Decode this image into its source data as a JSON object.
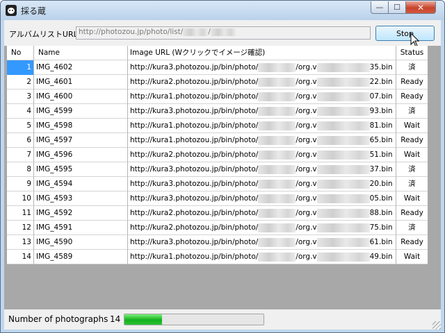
{
  "window": {
    "title": "採る蔵",
    "min_glyph": "—",
    "max_glyph": "☐",
    "close_glyph": "✕"
  },
  "album": {
    "label": "アルバムリストURL:",
    "url_prefix": "http://photozou.jp/photo/list/",
    "url_sep": "/"
  },
  "stop_button": {
    "label": "Stop"
  },
  "table": {
    "headers": {
      "no": "No",
      "name": "Name",
      "url": "Image URL (Wクリックでイメージ確認)",
      "status": "Status"
    },
    "rows": [
      {
        "no": "1",
        "name": "IMG_4602",
        "host": "kura3",
        "suffix": "35.bin",
        "status": "済"
      },
      {
        "no": "2",
        "name": "IMG_4601",
        "host": "kura2",
        "suffix": "22.bin",
        "status": "Ready"
      },
      {
        "no": "3",
        "name": "IMG_4600",
        "host": "kura1",
        "suffix": "07.bin",
        "status": "Ready"
      },
      {
        "no": "4",
        "name": "IMG_4599",
        "host": "kura3",
        "suffix": "93.bin",
        "status": "済"
      },
      {
        "no": "5",
        "name": "IMG_4598",
        "host": "kura1",
        "suffix": "81.bin",
        "status": "Wait"
      },
      {
        "no": "6",
        "name": "IMG_4597",
        "host": "kura1",
        "suffix": "65.bin",
        "status": "Ready"
      },
      {
        "no": "7",
        "name": "IMG_4596",
        "host": "kura2",
        "suffix": "51.bin",
        "status": "Wait"
      },
      {
        "no": "8",
        "name": "IMG_4595",
        "host": "kura3",
        "suffix": "37.bin",
        "status": "済"
      },
      {
        "no": "9",
        "name": "IMG_4594",
        "host": "kura3",
        "suffix": "20.bin",
        "status": "済"
      },
      {
        "no": "10",
        "name": "IMG_4593",
        "host": "kura3",
        "suffix": "05.bin",
        "status": "Wait"
      },
      {
        "no": "11",
        "name": "IMG_4592",
        "host": "kura2",
        "suffix": "88.bin",
        "status": "Ready"
      },
      {
        "no": "12",
        "name": "IMG_4591",
        "host": "kura2",
        "suffix": "75.bin",
        "status": "済"
      },
      {
        "no": "13",
        "name": "IMG_4590",
        "host": "kura3",
        "suffix": "61.bin",
        "status": "Ready"
      },
      {
        "no": "14",
        "name": "IMG_4589",
        "host": "kura1",
        "suffix": "49.bin",
        "status": "Wait"
      }
    ]
  },
  "status_bar": {
    "label": "Number of photographs",
    "count": "14",
    "progress_fraction": 0.27
  },
  "colors": {
    "selection": "#3399ff",
    "progress": "#14b01d",
    "close_button": "#c8432b"
  }
}
